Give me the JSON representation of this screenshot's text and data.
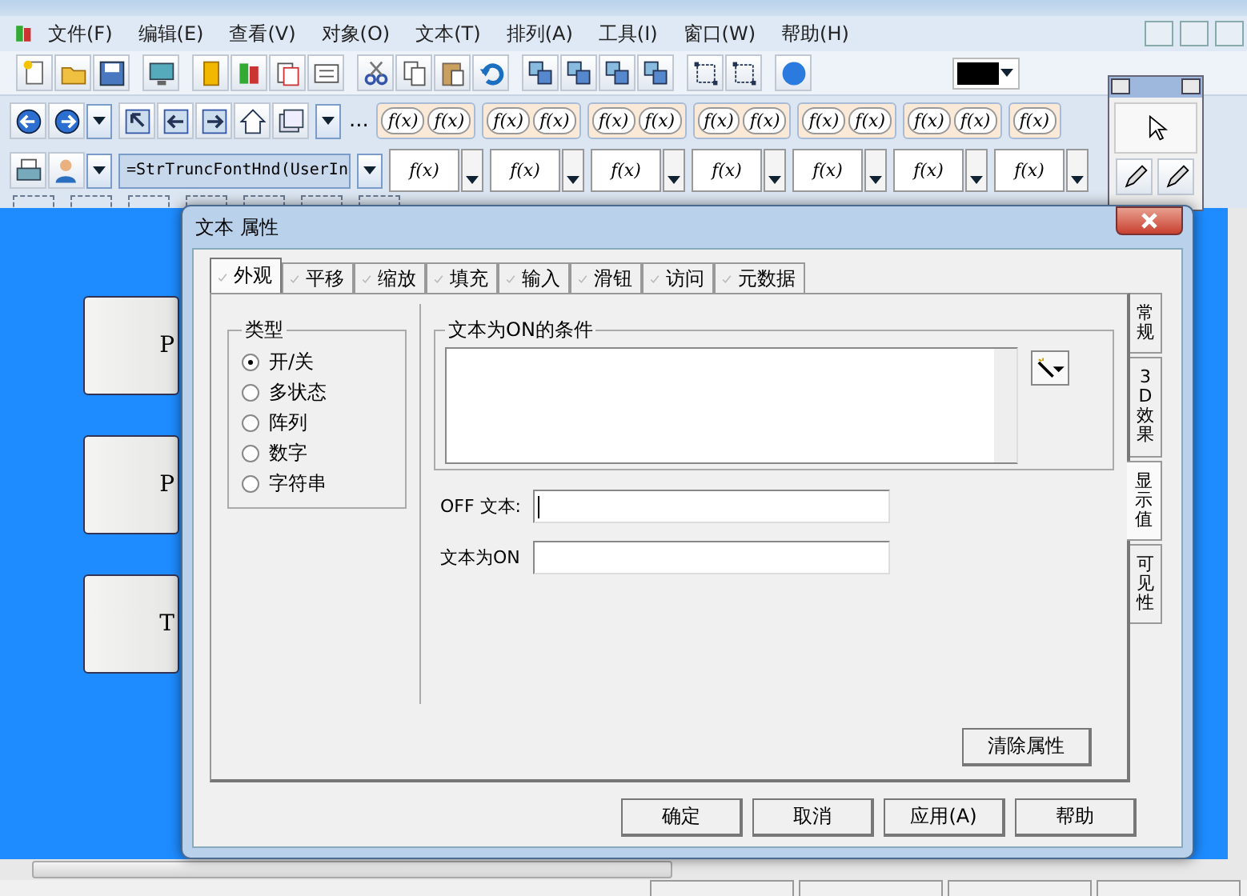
{
  "menu": [
    {
      "label": "文件(F)"
    },
    {
      "label": "编辑(E)"
    },
    {
      "label": "查看(V)"
    },
    {
      "label": "对象(O)"
    },
    {
      "label": "文本(T)"
    },
    {
      "label": "排列(A)"
    },
    {
      "label": "工具(I)"
    },
    {
      "label": "窗口(W)"
    },
    {
      "label": "帮助(H)"
    }
  ],
  "function_bar": {
    "overflow": "...",
    "expression": "=StrTruncFontHnd(UserIn",
    "pairs": [
      [
        "f(x)",
        "f(x)"
      ],
      [
        "f(x)",
        "f(x)"
      ],
      [
        "f(x)",
        "f(x)"
      ],
      [
        "f(x)",
        "f(x)"
      ],
      [
        "f(x)",
        "f(x)"
      ],
      [
        "f(x)",
        "f(x)"
      ],
      [
        "f(x)"
      ]
    ],
    "singles": [
      "f(x)",
      "f(x)",
      "f(x)",
      "f(x)",
      "f(x)",
      "f(x)",
      "f(x)"
    ]
  },
  "canvas": {
    "buttons": [
      {
        "label": "P"
      },
      {
        "label": "P"
      },
      {
        "label": "T"
      }
    ]
  },
  "dialog": {
    "title": "文本 属性",
    "tabs": [
      {
        "label": "外观",
        "selected": true
      },
      {
        "label": "平移",
        "selected": false
      },
      {
        "label": "缩放",
        "selected": false
      },
      {
        "label": "填充",
        "selected": false
      },
      {
        "label": "输入",
        "selected": false
      },
      {
        "label": "滑钮",
        "selected": false
      },
      {
        "label": "访问",
        "selected": false
      },
      {
        "label": "元数据",
        "selected": false
      }
    ],
    "side_tabs": [
      {
        "label": "常规",
        "selected": false
      },
      {
        "label": "3D 效果",
        "selected": false
      },
      {
        "label": "显示值",
        "selected": true
      },
      {
        "label": "可见性",
        "selected": false
      }
    ],
    "type_group": {
      "title": "类型",
      "options": [
        {
          "label": "开/关",
          "selected": true
        },
        {
          "label": "多状态",
          "selected": false
        },
        {
          "label": "阵列",
          "selected": false
        },
        {
          "label": "数字",
          "selected": false
        },
        {
          "label": "字符串",
          "selected": false
        }
      ]
    },
    "condition_group": {
      "title": "文本为ON的条件"
    },
    "fields": [
      {
        "label": "OFF 文本:"
      },
      {
        "label": "文本为ON"
      }
    ],
    "clear_button": "清除属性",
    "buttons": [
      "确定",
      "取消",
      "应用(A)",
      "帮助"
    ]
  }
}
